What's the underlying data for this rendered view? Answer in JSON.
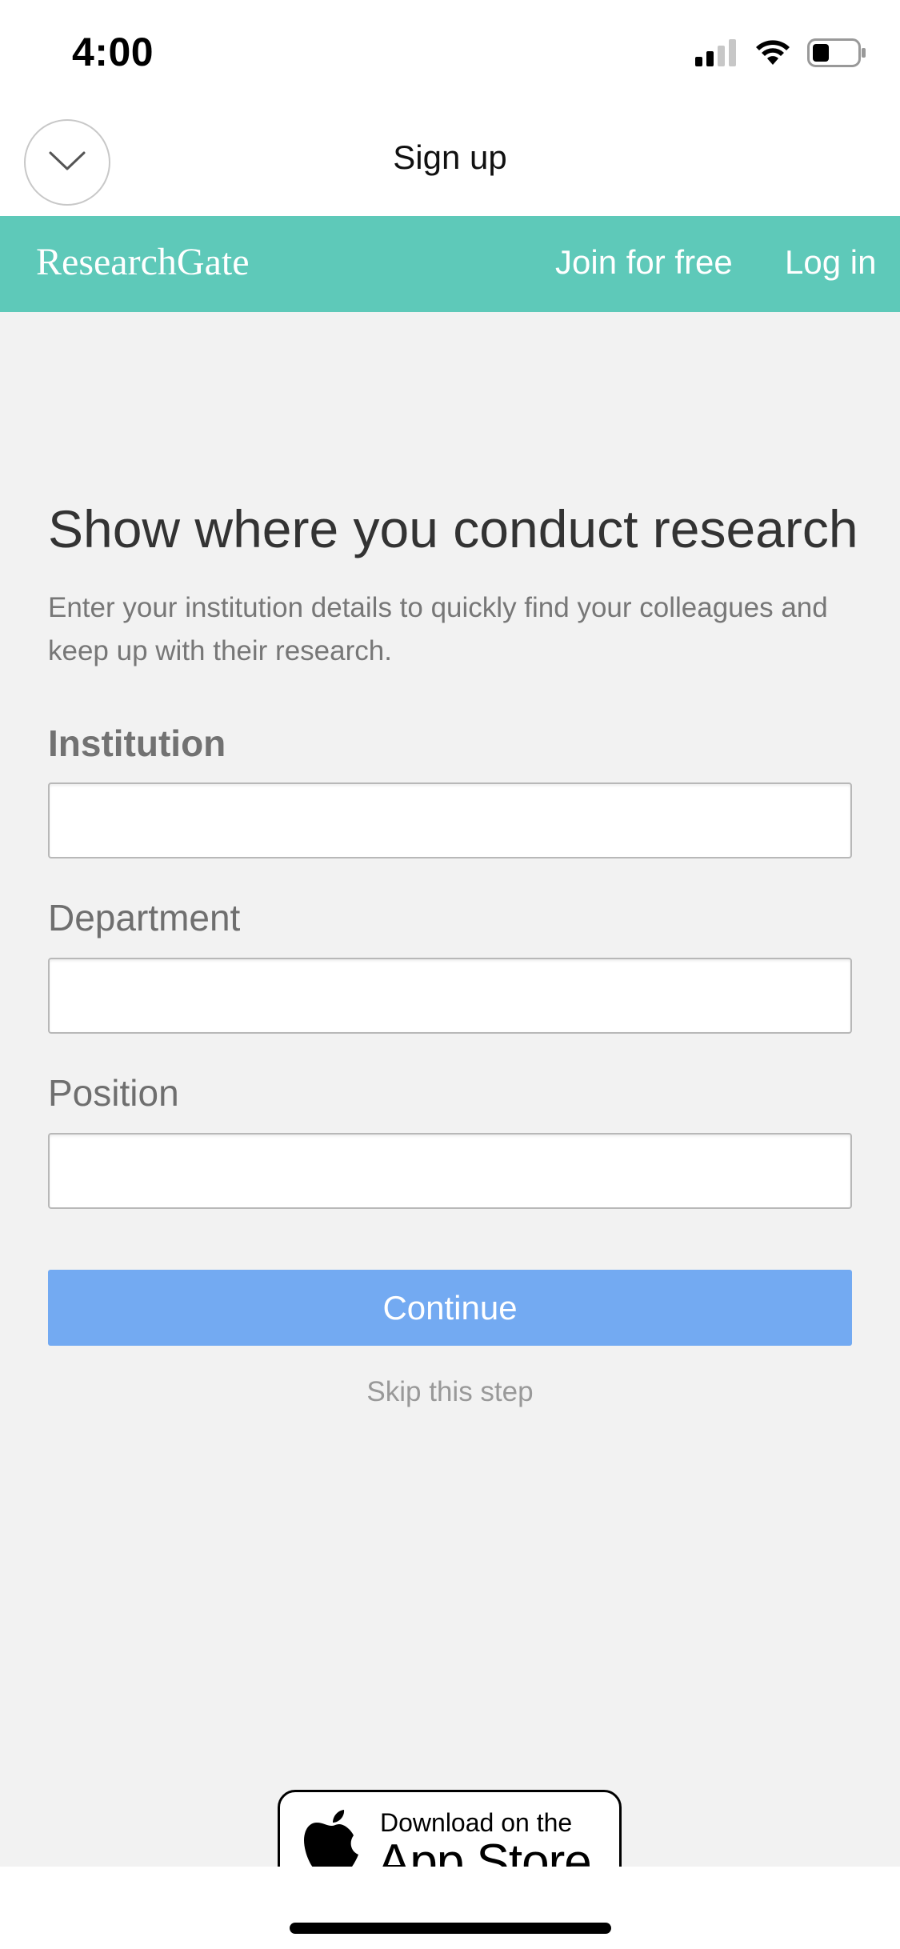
{
  "status_bar": {
    "time": "4:00"
  },
  "nav": {
    "title": "Sign up",
    "collapse_icon": "chevron-down-icon"
  },
  "rg_bar": {
    "logo": "ResearchGate",
    "join_label": "Join for free",
    "login_label": "Log in",
    "background_color": "#5ec9b9"
  },
  "form": {
    "title": "Show where you conduct research",
    "subtitle": "Enter your institution details to quickly find your colleagues and keep up with their research.",
    "institution": {
      "label": "Institution",
      "value": "",
      "placeholder": ""
    },
    "department": {
      "label": "Department",
      "value": "",
      "placeholder": ""
    },
    "position": {
      "label": "Position",
      "value": "",
      "placeholder": ""
    },
    "continue_label": "Continue",
    "continue_color": "#73aaf2",
    "skip_label": "Skip this step"
  },
  "app_store_badge": {
    "line1": "Download on the",
    "line2": "App Store",
    "icon": "apple-icon"
  }
}
